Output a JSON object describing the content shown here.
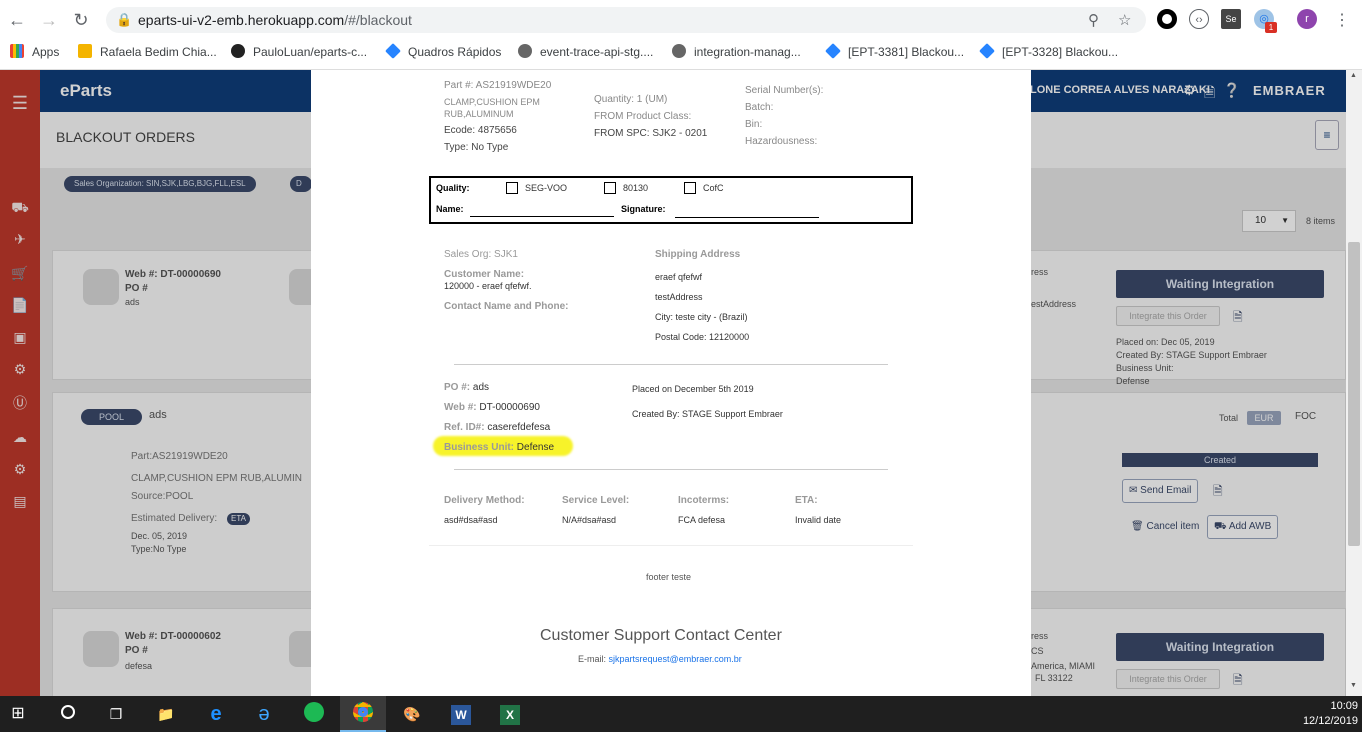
{
  "browser": {
    "url_host": "eparts-ui-v2-emb.herokuapp.com",
    "url_path": "/#/blackout",
    "bookmarks": [
      "Apps",
      "Rafaela Bedim Chia...",
      "PauloLuan/eparts-c...",
      "Quadros Rápidos",
      "event-trace-api-stg....",
      "integration-manag...",
      "[EPT-3381] Blackou...",
      "[EPT-3328] Blackou..."
    ],
    "profile_initial": "r",
    "badge_count": "1"
  },
  "app": {
    "brand": "eParts",
    "user_name": "LONE CORREA ALVES NARAZAKI",
    "company_logo": "EMBRAER",
    "page_title": "BLACKOUT ORDERS",
    "filter_chip": "Sales Organization: SIN,SJK,LBG,BJG,FLL,ESL",
    "filter_chip2": "D",
    "page_size": "10",
    "items_count": "8 items"
  },
  "orders": [
    {
      "web_label": "Web #: DT-00000690",
      "po_label": "PO #",
      "po_value": "ads",
      "status": "Waiting Integration",
      "integrate_label": "Integrate this Order",
      "ress": "ress",
      "address_frag": "estAddress",
      "placed_on": "Placed on: Dec 05, 2019",
      "created_by": "Created By: STAGE Support Embraer",
      "business_unit_label": "Business Unit:",
      "business_unit_value": "Defense",
      "pool_tag": "POOL",
      "pool_value": "ads",
      "total_label": "Total",
      "currency": "EUR",
      "foc": "FOC",
      "part": "Part:AS21919WDE20",
      "part_desc": "CLAMP,CUSHION EPM RUB,ALUMIN",
      "source": "Source:POOL",
      "est_delivery": "Estimated Delivery:",
      "eta_tag": "ETA",
      "est_date": "Dec. 05, 2019",
      "type": "Type:No Type",
      "item_status": "Created",
      "send_email": "Send Email",
      "cancel_item": "Cancel item",
      "add_awb": "Add AWB"
    },
    {
      "web_label": "Web #: DT-00000602",
      "po_label": "PO #",
      "po_value": "defesa",
      "status": "Waiting Integration",
      "integrate_label": "Integrate this Order",
      "ress": "ress",
      "cs": "CS",
      "address_frag": "America, MIAMI",
      "address_frag2": "FL 33122"
    }
  ],
  "modal": {
    "part_no": "Part #: AS21919WDE20",
    "part_desc1": "CLAMP,CUSHION EPM",
    "part_desc2": "RUB,ALUMINUM",
    "ecode": "Ecode: 4875656",
    "type": "Type: No Type",
    "quantity": "Quantity: 1 (UM)",
    "from_product_class": "FROM Product Class:",
    "from_spc": "FROM SPC: SJK2 - 0201",
    "serial_numbers": "Serial Number(s):",
    "batch": "Batch:",
    "bin": "Bin:",
    "hazardousness": "Hazardousness:",
    "quality_label": "Quality:",
    "quality_opts": [
      "SEG-VOO",
      "80130",
      "CofC"
    ],
    "name_label": "Name:",
    "signature_label": "Signature:",
    "sales_org": "Sales Org: SJK1",
    "customer_name_label": "Customer Name:",
    "customer_name_value": "120000 - eraef qfefwf.",
    "contact_label": "Contact Name and Phone:",
    "shipping_address_label": "Shipping Address",
    "ship_line1": "eraef qfefwf",
    "ship_line2": "testAddress",
    "ship_city": "City: teste city - (Brazil)",
    "ship_postal": "Postal Code: 12120000",
    "po_label": "PO #:",
    "po_value": "ads",
    "web_label": "Web #:",
    "web_value": "DT-00000690",
    "ref_label": "Ref. ID#:",
    "ref_value": "caserefdefesa",
    "bu_label": "Business Unit:",
    "bu_value": "Defense",
    "placed_on": "Placed on December 5th 2019",
    "created_by": "Created By: STAGE Support Embraer",
    "delivery_method_label": "Delivery Method:",
    "delivery_method_value": "asd#dsa#asd",
    "service_level_label": "Service Level:",
    "service_level_value": "N/A#dsa#asd",
    "incoterms_label": "Incoterms:",
    "incoterms_value": "FCA defesa",
    "eta_label": "ETA:",
    "eta_value": "Invalid date",
    "footer": "footer teste",
    "contact_center": "Customer Support Contact Center",
    "email_label": "E-mail:",
    "email_value": "sjkpartsrequest@embraer.com.br"
  },
  "taskbar": {
    "time": "10:09",
    "date": "12/12/2019"
  }
}
